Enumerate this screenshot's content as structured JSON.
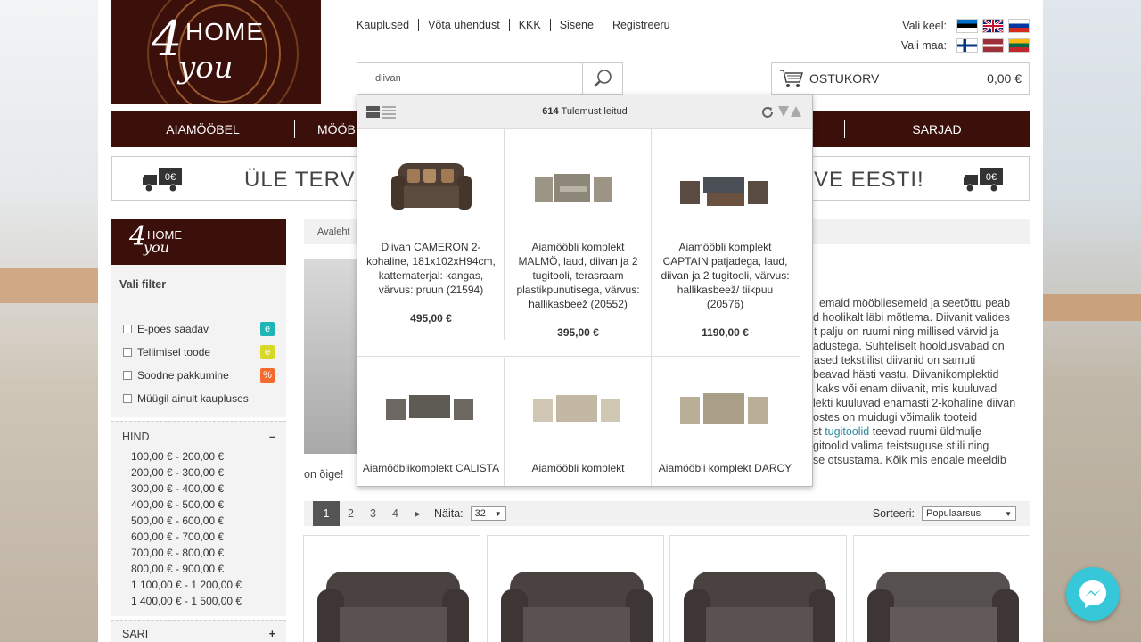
{
  "header": {
    "logo_home": "HOME",
    "logo_four": "4",
    "logo_you": "you",
    "links": [
      "Kauplused",
      "Võta ühendust",
      "KKK",
      "Sisene",
      "Registreeru"
    ],
    "lang_label": "Vali keel:",
    "country_label": "Vali maa:",
    "search_value": "diivan",
    "cart_label": "OSTUKORV",
    "cart_total": "0,00 €"
  },
  "nav": {
    "items": [
      "AIAMÖÖBEL",
      "MÖÖB",
      "SARJAD"
    ]
  },
  "banner": {
    "text_left": "ÜLE TERVE E",
    "text_right": "VE EESTI!",
    "truck_label": "0€"
  },
  "sidebar": {
    "filter_title": "Vali filter",
    "checkboxes": [
      {
        "label": "E-poes saadav",
        "badge": "e",
        "color": "#1fb4b5"
      },
      {
        "label": "Tellimisel toode",
        "badge": "e",
        "color": "#d8d926"
      },
      {
        "label": "Soodne pakkumine",
        "badge": "%",
        "color": "#f26a2e"
      },
      {
        "label": "Müügil ainult kaupluses",
        "badge": "",
        "color": ""
      }
    ],
    "price_title": "HIND",
    "price_toggle": "–",
    "prices": [
      "100,00 € - 200,00 €",
      "200,00 € - 300,00 €",
      "300,00 € - 400,00 €",
      "400,00 € - 500,00 €",
      "500,00 € - 600,00 €",
      "600,00 € - 700,00 €",
      "700,00 € - 800,00 €",
      "800,00 € - 900,00 €",
      "1 100,00 € - 1 200,00 €",
      "1 400,00 € - 1 500,00 €"
    ],
    "series_title": "SARI",
    "series_toggle": "+"
  },
  "breadcrumb": "Avaleht",
  "description": {
    "lines": [
      "emaid mööbliesemeid ja seetõttu peab",
      "d hoolikalt läbi mõtlema. Diivanit valides",
      "t palju on ruumi ning millised värvid ja",
      "adustega. Suhteliselt hooldusvabad on",
      "ased tekstiilist diivanid on samuti",
      "beavad hästi vastu. Diivanikomplektid",
      "kaks või enam diivanit, mis kuuluvad",
      "lekti kuuluvad enamasti 2-kohaline diivan",
      "ostes on muidugi võimalik tooteid"
    ],
    "line10_pre": "st ",
    "line10_link": "tugitoolid",
    "line10_post": " teevad ruumi üldmulje",
    "line11": "gitoolid valima teistsuguse stiili ning",
    "line12": "se otsustama. Kõik mis endale meeldib",
    "line13": "on õige!"
  },
  "pager": {
    "pages": [
      "1",
      "2",
      "3",
      "4"
    ],
    "next": "▸",
    "show_label": "Näita:",
    "show_value": "32",
    "sort_label": "Sorteeri:",
    "sort_value": "Populaarsus"
  },
  "dropdown": {
    "count": "614",
    "count_label": "Tulemust leitud",
    "items": [
      {
        "name": "Diivan CAMERON 2-kohaline, 181x102xH94cm, kattematerjal: kangas, värvus: pruun (21594)",
        "price": "495,00 €"
      },
      {
        "name": "Aiamööbli komplekt MALMÖ, laud, diivan ja 2 tugitooli, terasraam plastikpunutisega, värvus: hallikasbeež (20552)",
        "price": "395,00 €"
      },
      {
        "name": "Aiamööbli komplekt CAPTAIN patjadega, laud, diivan ja 2 tugitooli, värvus: hallikasbeež/ tiikpuu (20576)",
        "price": "1190,00 €"
      },
      {
        "name": "Aiamööblikomplekt CALISTA",
        "price": ""
      },
      {
        "name": "Aiamööbli komplekt",
        "price": ""
      },
      {
        "name": "Aiamööbli komplekt DARCY",
        "price": ""
      }
    ]
  },
  "colors": {
    "brand": "#3b0f0a",
    "link": "#2a8aa0",
    "messenger": "#36c7d8"
  }
}
